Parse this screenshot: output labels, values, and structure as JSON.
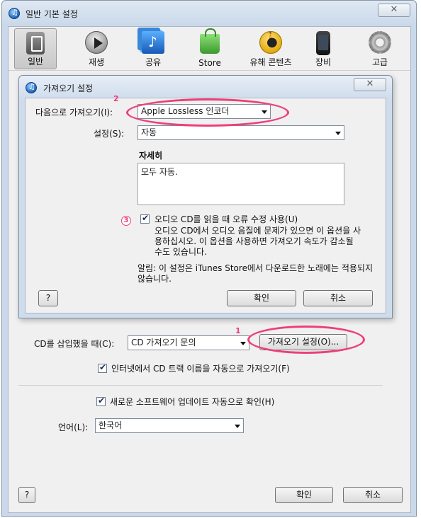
{
  "window": {
    "title": "일반 기본 설정",
    "close_label": "✕"
  },
  "toolbar": {
    "tabs": [
      {
        "label": "일반",
        "icon": "general-switch-icon",
        "active": true
      },
      {
        "label": "재생",
        "icon": "play-icon"
      },
      {
        "label": "공유",
        "icon": "share-music-icon"
      },
      {
        "label": "Store",
        "icon": "shopping-bag-icon"
      },
      {
        "label": "유해 콘텐츠",
        "icon": "parental-icon"
      },
      {
        "label": "장비",
        "icon": "device-icon"
      },
      {
        "label": "고급",
        "icon": "gear-icon"
      }
    ]
  },
  "main": {
    "cd_insert_label": "CD를 삽입했을 때(C):",
    "cd_insert_value": "CD 가져오기 문의",
    "import_settings_button": "가져오기 설정(O)...",
    "auto_names_label": "인터넷에서 CD 트랙 이름을 자동으로 가져오기(F)",
    "auto_update_label": "새로운 소프트웨어 업데이트 자동으로 확인(H)",
    "language_label": "언어(L):",
    "language_value": "한국어",
    "help_label": "?",
    "ok_label": "확인",
    "cancel_label": "취소"
  },
  "dialog": {
    "title": "가져오기 설정",
    "close_label": "✕",
    "import_using_label": "다음으로 가져오기(I):",
    "import_using_value": "Apple Lossless 인코더",
    "setting_label": "설정(S):",
    "setting_value": "자동",
    "details_heading": "자세히",
    "details_text": "모두 자동.",
    "error_correction_label": "오디오 CD를 읽을 때 오류 수정 사용(U)",
    "error_correction_desc": "오디오 CD에서 오디오 음질에 문제가 있으면 이 옵션을 사용하십시오. 이 옵션을 사용하면 가져오기 속도가 감소될 수도 있습니다.",
    "notice": "알림: 이 설정은 iTunes Store에서 다운로드한 노래에는 적용되지 않습니다.",
    "help_label": "?",
    "ok_label": "확인",
    "cancel_label": "취소"
  },
  "annotations": {
    "marker_1": "1",
    "marker_2": "2",
    "marker_3": "3",
    "color": "#ee3f79"
  }
}
